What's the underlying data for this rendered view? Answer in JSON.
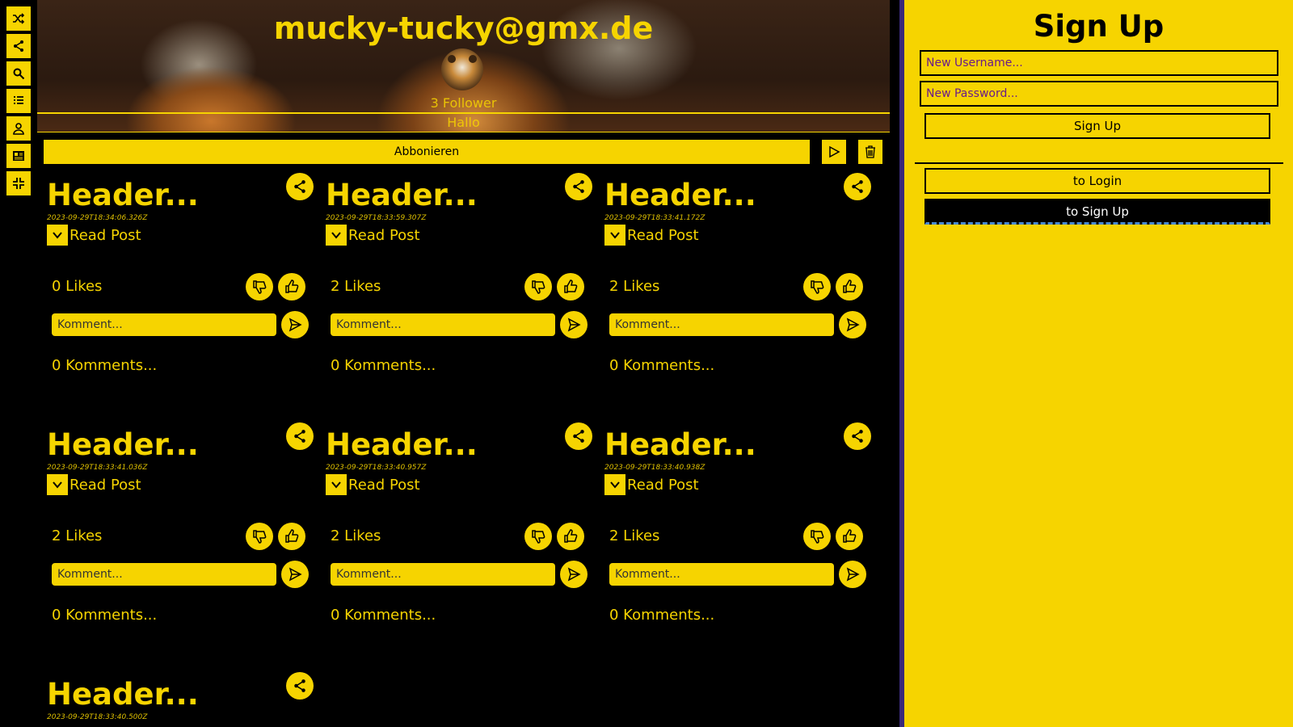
{
  "rail": {
    "icons": [
      "shuffle-icon",
      "share-icon",
      "search-icon",
      "list-icon",
      "user-icon",
      "newspaper-icon",
      "collapse-icon"
    ]
  },
  "profile": {
    "title": "mucky-tucky@gmx.de",
    "followers": "3 Follower",
    "bio": "Hallo",
    "subscribe_label": "Abbonieren"
  },
  "posts": [
    {
      "title": "Header...",
      "date": "2023-09-29T18:34:06.326Z",
      "read_label": "Read Post",
      "likes": "0 Likes",
      "comment_placeholder": "Komment...",
      "comments": "0 Komments..."
    },
    {
      "title": "Header...",
      "date": "2023-09-29T18:33:59.307Z",
      "read_label": "Read Post",
      "likes": "2 Likes",
      "comment_placeholder": "Komment...",
      "comments": "0 Komments..."
    },
    {
      "title": "Header...",
      "date": "2023-09-29T18:33:41.172Z",
      "read_label": "Read Post",
      "likes": "2 Likes",
      "comment_placeholder": "Komment...",
      "comments": "0 Komments..."
    },
    {
      "title": "Header...",
      "date": "2023-09-29T18:33:41.036Z",
      "read_label": "Read Post",
      "likes": "2 Likes",
      "comment_placeholder": "Komment...",
      "comments": "0 Komments..."
    },
    {
      "title": "Header...",
      "date": "2023-09-29T18:33:40.957Z",
      "read_label": "Read Post",
      "likes": "2 Likes",
      "comment_placeholder": "Komment...",
      "comments": "0 Komments..."
    },
    {
      "title": "Header...",
      "date": "2023-09-29T18:33:40.938Z",
      "read_label": "Read Post",
      "likes": "2 Likes",
      "comment_placeholder": "Komment...",
      "comments": "0 Komments..."
    },
    {
      "title": "Header...",
      "date": "2023-09-29T18:33:40.500Z"
    }
  ],
  "signup": {
    "title": "Sign Up",
    "username_placeholder": "New Username...",
    "password_placeholder": "New Password...",
    "submit_label": "Sign Up",
    "to_login_label": "to Login",
    "to_signup_label": "to Sign Up"
  },
  "colors": {
    "accent": "#f6d400",
    "background": "#000000",
    "field_text": "#6a1a8a",
    "divider": "#3b2a7a"
  }
}
